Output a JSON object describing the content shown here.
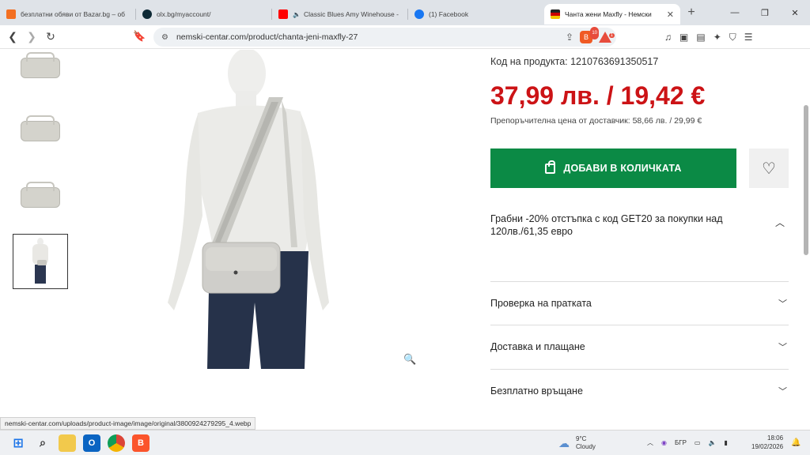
{
  "browser": {
    "tabs": [
      {
        "title": "безплатни обяви от Bazar.bg – об",
        "color": "#f36f21",
        "active": false
      },
      {
        "title": "olx.bg/myaccount/",
        "color": "#23e5db",
        "active": false
      },
      {
        "title": "Classic Blues Amy Winehouse -",
        "color": "#ff0000",
        "active": false,
        "muted": true
      },
      {
        "title": "(1) Facebook",
        "color": "#1877f2",
        "active": false
      },
      {
        "title": "Чанта жени Maxfly - Немски",
        "color": "#cc0000",
        "active": true
      }
    ],
    "new_tab": "+",
    "url": "nemski-centar.com/product/chanta-jeni-maxfly-27",
    "brave_badge": "10",
    "rewards_badge": "1",
    "window_controls": [
      "—",
      "❐",
      "✕"
    ]
  },
  "product": {
    "code_label": "Код на продукта: 1210763691350517",
    "price": "37,99 лв. / 19,42 €",
    "rrp": "Препоръчителна цена от доставчик: 58,66 лв. / 29,99 €",
    "add_to_cart": "ДОБАВИ В КОЛИЧКАТА",
    "wishlist_icon": "♡",
    "promo": "Грабни -20% отстъпка с код GET20 за покупки над 120лв./61,35 евро",
    "accordions": [
      {
        "label": "Проверка на пратката"
      },
      {
        "label": "Доставка и плащане"
      },
      {
        "label": "Безплатно връщане"
      }
    ]
  },
  "status_url": "nemski-centar.com/uploads/product-image/image/original/3800924279295_4.webp",
  "taskbar": {
    "weather_temp": "9°C",
    "weather_desc": "Cloudy",
    "lang": "БГР",
    "time": "18:06",
    "date": "19/02/2026"
  },
  "colors": {
    "price_red": "#cc1316",
    "cart_green": "#0b8a45"
  }
}
